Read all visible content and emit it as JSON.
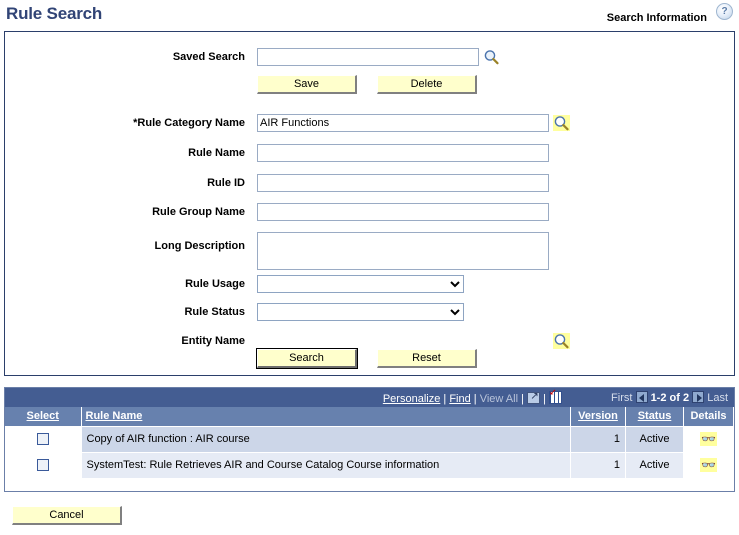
{
  "header": {
    "title": "Rule Search",
    "search_information_label": "Search Information",
    "help_icon": "help-icon",
    "help_glyph": "?"
  },
  "form": {
    "fields": [
      {
        "label": "Saved Search",
        "value": "",
        "type": "text",
        "lookup": "search-icon",
        "lookup_required": false
      },
      {
        "label": "*Rule Category Name",
        "value": "AIR Functions",
        "type": "text",
        "lookup": "search-icon",
        "lookup_required": true
      },
      {
        "label": "Rule Name",
        "value": "",
        "type": "text",
        "lookup": null
      },
      {
        "label": "Rule ID",
        "value": "",
        "type": "text",
        "lookup": null
      },
      {
        "label": "Rule Group Name",
        "value": "",
        "type": "text",
        "lookup": null
      },
      {
        "label": "Long Description",
        "value": "",
        "type": "textarea",
        "lookup": null
      },
      {
        "label": "Rule Usage",
        "value": "",
        "type": "select",
        "options": [
          ""
        ]
      },
      {
        "label": "Rule Status",
        "value": "",
        "type": "select",
        "options": [
          ""
        ]
      },
      {
        "label": "Entity Name",
        "value": "",
        "type": "lookup-only",
        "lookup": "search-icon",
        "lookup_required": true
      }
    ],
    "buttons": {
      "save": "Save",
      "delete": "Delete",
      "search": "Search",
      "reset": "Reset"
    }
  },
  "grid": {
    "nav": {
      "personalize": "Personalize",
      "find": "Find",
      "view_all": "View All",
      "sep": "|",
      "expand_icon": "expand-icon",
      "download-icon": "download-grid-icon",
      "first": "First",
      "last": "Last",
      "range": "1-2 of 2",
      "prev_icon": "previous-page-icon",
      "next_icon": "next-page-icon"
    },
    "columns": [
      "Select",
      "Rule Name",
      "Version",
      "Status",
      "Details"
    ],
    "rows": [
      {
        "selected": false,
        "rule_name": "Copy of AIR function : AIR course",
        "version": "1",
        "status": "Active",
        "details_icon": "view-details-icon"
      },
      {
        "selected": false,
        "rule_name": "SystemTest: Rule Retrieves AIR and Course Catalog Course information",
        "version": "1",
        "status": "Active",
        "details_icon": "view-details-icon"
      }
    ]
  },
  "footer": {
    "cancel": "Cancel"
  },
  "colors": {
    "title": "#314476",
    "panel_border": "#2b3f6b",
    "grid_navbar": "#445d92",
    "grid_header": "#6781ae",
    "row_a": "#ccd6e8",
    "row_b": "#e6ebf5",
    "button_face": "#ffffcc",
    "required_lookup": "#ffff9e"
  }
}
